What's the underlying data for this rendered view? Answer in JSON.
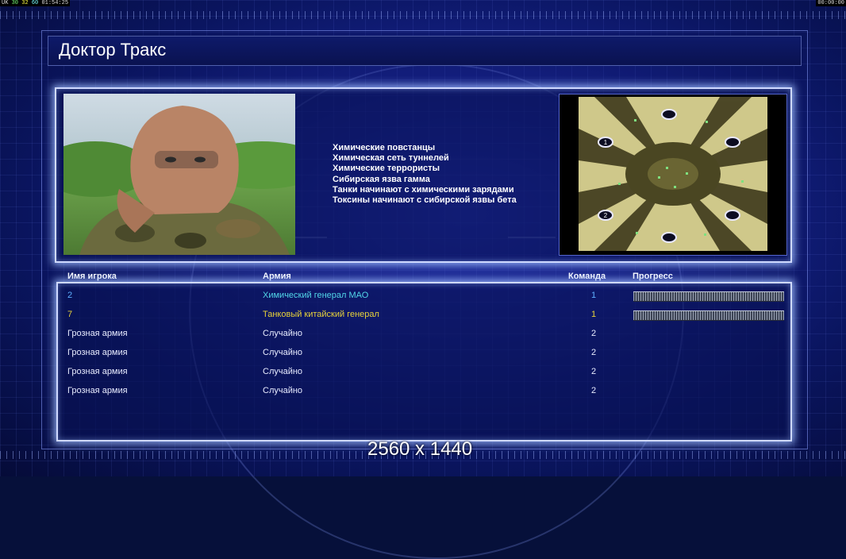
{
  "hud": {
    "left_a": "UK",
    "left_b": "30",
    "left_c": "32",
    "left_d": "60",
    "left_time": "01:54:25",
    "right_time": "00:00:00"
  },
  "screen": {
    "title": "Доктор Тракс"
  },
  "general": {
    "rules": [
      "Химические повстанцы",
      "Химическая сеть туннелей",
      "Химические террористы",
      "Сибирская язва гамма",
      "Танки начинают с химическими зарядами",
      "Токсины начинают с сибирской язвы бета"
    ]
  },
  "map": {
    "start_labels": [
      "1",
      "2"
    ]
  },
  "table": {
    "headers": {
      "name": "Имя игрока",
      "army": "Армия",
      "team": "Команда",
      "progress": "Прогресс"
    },
    "rows": [
      {
        "name": "2",
        "army": "Химический генерал МАО",
        "team": "1",
        "color": "#5fb0ff",
        "army_color": "#52d6e8",
        "progress": 1.0
      },
      {
        "name": "7",
        "army": "Танковый китайский генерал",
        "team": "1",
        "color": "#e8d23a",
        "army_color": "#e8d23a",
        "progress": 1.0
      },
      {
        "name": "Грозная армия",
        "army": "Случайно",
        "team": "2",
        "color": "#e8ecff",
        "army_color": "#e8ecff"
      },
      {
        "name": "Грозная армия",
        "army": "Случайно",
        "team": "2",
        "color": "#e8ecff",
        "army_color": "#e8ecff"
      },
      {
        "name": "Грозная армия",
        "army": "Случайно",
        "team": "2",
        "color": "#e8ecff",
        "army_color": "#e8ecff"
      },
      {
        "name": "Грозная армия",
        "army": "Случайно",
        "team": "2",
        "color": "#e8ecff",
        "army_color": "#e8ecff"
      }
    ]
  },
  "footer": {
    "resolution": "2560 x 1440"
  }
}
